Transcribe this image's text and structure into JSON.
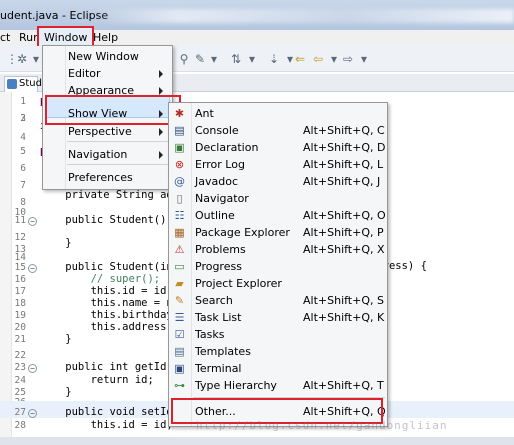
{
  "window": {
    "title": "udent.java - Eclipse"
  },
  "menubar": {
    "items": [
      {
        "label": "ct"
      },
      {
        "label": "Run"
      },
      {
        "label": "Window"
      },
      {
        "label": "Help"
      }
    ]
  },
  "editor": {
    "tab_label": "Stud",
    "lines": [
      {
        "num": "1",
        "text": "p"
      },
      {
        "num": "2",
        "text": ""
      },
      {
        "num": "3",
        "text": "i"
      },
      {
        "num": "4",
        "text": ""
      },
      {
        "num": "5",
        "text": "p"
      },
      {
        "num": "6",
        "text": ""
      },
      {
        "num": "7",
        "text": ""
      },
      {
        "num": "8",
        "text": ""
      },
      {
        "num": "9",
        "text": "    private String addre"
      },
      {
        "num": "10",
        "text": ""
      },
      {
        "num": "11",
        "text": "    public Student() {"
      },
      {
        "num": "12",
        "text": ""
      },
      {
        "num": "13",
        "text": "    }"
      },
      {
        "num": "14",
        "text": ""
      },
      {
        "num": "15",
        "text": "    public Student(int i"
      },
      {
        "num": "16",
        "text": "        // super();"
      },
      {
        "num": "17",
        "text": "        this.id = id;"
      },
      {
        "num": "18",
        "text": "        this.name = name"
      },
      {
        "num": "19",
        "text": "        this.birthday ="
      },
      {
        "num": "20",
        "text": "        this.address = a"
      },
      {
        "num": "21",
        "text": "    }"
      },
      {
        "num": "22",
        "text": ""
      },
      {
        "num": "23",
        "text": "    public int getId() {"
      },
      {
        "num": "24",
        "text": "        return id;"
      },
      {
        "num": "25",
        "text": "    }"
      },
      {
        "num": "26",
        "text": ""
      },
      {
        "num": "27",
        "text": "    public void setId(in"
      },
      {
        "num": "28",
        "text": "        this.id = id;"
      }
    ],
    "right_overflow_text": "ddress) {"
  },
  "window_menu": {
    "items": [
      {
        "label": "New Window"
      },
      {
        "label": "Editor"
      },
      {
        "label": "Appearance"
      },
      {
        "label": "Show View"
      },
      {
        "label": "Perspective"
      },
      {
        "label": "Navigation"
      },
      {
        "label": "Preferences"
      }
    ]
  },
  "show_view_menu": {
    "items": [
      {
        "label": "Ant",
        "shortcut": "",
        "icon": "ant-icon"
      },
      {
        "label": "Console",
        "shortcut": "Alt+Shift+Q, C",
        "icon": "console-icon"
      },
      {
        "label": "Declaration",
        "shortcut": "Alt+Shift+Q, D",
        "icon": "declaration-icon"
      },
      {
        "label": "Error Log",
        "shortcut": "Alt+Shift+Q, L",
        "icon": "error-log-icon"
      },
      {
        "label": "Javadoc",
        "shortcut": "Alt+Shift+Q, J",
        "icon": "javadoc-icon"
      },
      {
        "label": "Navigator",
        "shortcut": "",
        "icon": "navigator-icon"
      },
      {
        "label": "Outline",
        "shortcut": "Alt+Shift+Q, O",
        "icon": "outline-icon"
      },
      {
        "label": "Package Explorer",
        "shortcut": "Alt+Shift+Q, P",
        "icon": "package-explorer-icon"
      },
      {
        "label": "Problems",
        "shortcut": "Alt+Shift+Q, X",
        "icon": "problems-icon"
      },
      {
        "label": "Progress",
        "shortcut": "",
        "icon": "progress-icon"
      },
      {
        "label": "Project Explorer",
        "shortcut": "",
        "icon": "project-explorer-icon"
      },
      {
        "label": "Search",
        "shortcut": "Alt+Shift+Q, S",
        "icon": "search-icon"
      },
      {
        "label": "Task List",
        "shortcut": "Alt+Shift+Q, K",
        "icon": "task-list-icon"
      },
      {
        "label": "Tasks",
        "shortcut": "",
        "icon": "tasks-icon"
      },
      {
        "label": "Templates",
        "shortcut": "",
        "icon": "templates-icon"
      },
      {
        "label": "Terminal",
        "shortcut": "",
        "icon": "terminal-icon"
      },
      {
        "label": "Type Hierarchy",
        "shortcut": "Alt+Shift+Q, T",
        "icon": "type-hierarchy-icon"
      },
      {
        "label": "Other...",
        "shortcut": "Alt+Shift+Q, Q",
        "icon": ""
      }
    ]
  },
  "watermark": "http://blog.csdn.net/gandongliian",
  "colors": {
    "highlight_box": "#e0202a",
    "menu_hover": "#d6e8fb",
    "keyword": "#7f0055"
  }
}
